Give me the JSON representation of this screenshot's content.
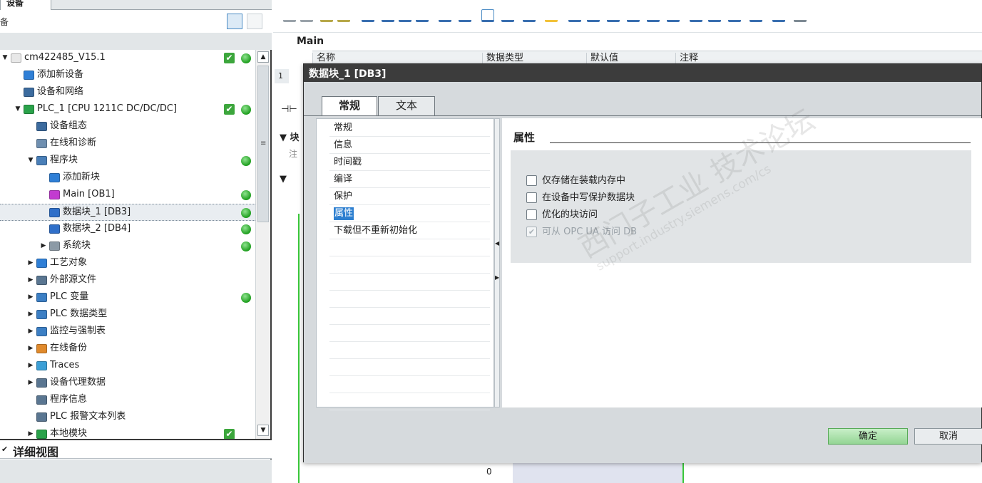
{
  "project_tree": {
    "tab_label": "设备",
    "toolbar_label": "备",
    "items": [
      {
        "label": "cm422485_V15.1",
        "indent": 0,
        "twisty": "▼",
        "icon_color": "#e8e8e8",
        "check": true,
        "dot": true
      },
      {
        "label": "添加新设备",
        "indent": 1,
        "twisty": "",
        "icon_color": "#2f7fd6"
      },
      {
        "label": "设备和网络",
        "indent": 1,
        "twisty": "",
        "icon_color": "#3c6b9e"
      },
      {
        "label": "PLC_1 [CPU 1211C DC/DC/DC]",
        "indent": 1,
        "twisty": "▼",
        "icon_color": "#2aa24a",
        "check": true,
        "dot": true
      },
      {
        "label": "设备组态",
        "indent": 2,
        "twisty": "",
        "icon_color": "#3c6b9e"
      },
      {
        "label": "在线和诊断",
        "indent": 2,
        "twisty": "",
        "icon_color": "#6f8fb0"
      },
      {
        "label": "程序块",
        "indent": 2,
        "twisty": "▼",
        "icon_color": "#4a7fb8",
        "dot": true
      },
      {
        "label": "添加新块",
        "indent": 3,
        "twisty": "",
        "icon_color": "#2f7fd6"
      },
      {
        "label": "Main [OB1]",
        "indent": 3,
        "twisty": "",
        "icon_color": "#c23bd0",
        "dot": true
      },
      {
        "label": "数据块_1 [DB3]",
        "indent": 3,
        "twisty": "",
        "icon_color": "#2f6fc9",
        "dot": true,
        "selected": true
      },
      {
        "label": "数据块_2 [DB4]",
        "indent": 3,
        "twisty": "",
        "icon_color": "#2f6fc9",
        "dot": true
      },
      {
        "label": "系统块",
        "indent": 3,
        "twisty": "▶",
        "icon_color": "#8c9aa6",
        "dot": true
      },
      {
        "label": "工艺对象",
        "indent": 2,
        "twisty": "▶",
        "icon_color": "#2f7fd6"
      },
      {
        "label": "外部源文件",
        "indent": 2,
        "twisty": "▶",
        "icon_color": "#5a7691"
      },
      {
        "label": "PLC 变量",
        "indent": 2,
        "twisty": "▶",
        "icon_color": "#3c7fc4",
        "dot": true
      },
      {
        "label": "PLC 数据类型",
        "indent": 2,
        "twisty": "▶",
        "icon_color": "#3c7fc4"
      },
      {
        "label": "监控与强制表",
        "indent": 2,
        "twisty": "▶",
        "icon_color": "#3c7fc4"
      },
      {
        "label": "在线备份",
        "indent": 2,
        "twisty": "▶",
        "icon_color": "#e08a2c"
      },
      {
        "label": "Traces",
        "indent": 2,
        "twisty": "▶",
        "icon_color": "#3c9fd6"
      },
      {
        "label": "设备代理数据",
        "indent": 2,
        "twisty": "▶",
        "icon_color": "#5a7691"
      },
      {
        "label": "程序信息",
        "indent": 2,
        "twisty": "",
        "icon_color": "#5a7691"
      },
      {
        "label": "PLC 报警文本列表",
        "indent": 2,
        "twisty": "",
        "icon_color": "#5a7691"
      },
      {
        "label": "本地模块",
        "indent": 2,
        "twisty": "▶",
        "icon_color": "#2aa24a",
        "check": true
      }
    ]
  },
  "detail_view": {
    "title": "详细视图"
  },
  "editor": {
    "title": "Main",
    "columns": [
      "名称",
      "数据类型",
      "默认值",
      "注释"
    ],
    "gutter_number": "1",
    "block_collapse_char": "块",
    "block_comment_char": "注",
    "bottom_number": "0"
  },
  "dialog": {
    "title": "数据块_1 [DB3]",
    "tabs": [
      "常规",
      "文本"
    ],
    "nav_items": [
      "常规",
      "信息",
      "时间戳",
      "编译",
      "保护",
      "属性",
      "下载但不重新初始化"
    ],
    "selected_nav": "属性",
    "section_heading": "属性",
    "options": [
      {
        "label": "仅存储在装载内存中",
        "checked": false,
        "disabled": false
      },
      {
        "label": "在设备中写保护数据块",
        "checked": false,
        "disabled": false
      },
      {
        "label": "优化的块访问",
        "checked": false,
        "disabled": false
      },
      {
        "label": "可从 OPC UA 访问 DB",
        "checked": true,
        "disabled": true
      }
    ],
    "ok_label": "确定",
    "cancel_label": "取消",
    "watermark": "西门子工业 技术论坛",
    "watermark_url": "support.industry.siemens.com/cs"
  },
  "colors": {
    "status_green": "#1e9e1e",
    "selection_blue": "#2d7fd0",
    "title_bar": "#3c3c3c"
  }
}
